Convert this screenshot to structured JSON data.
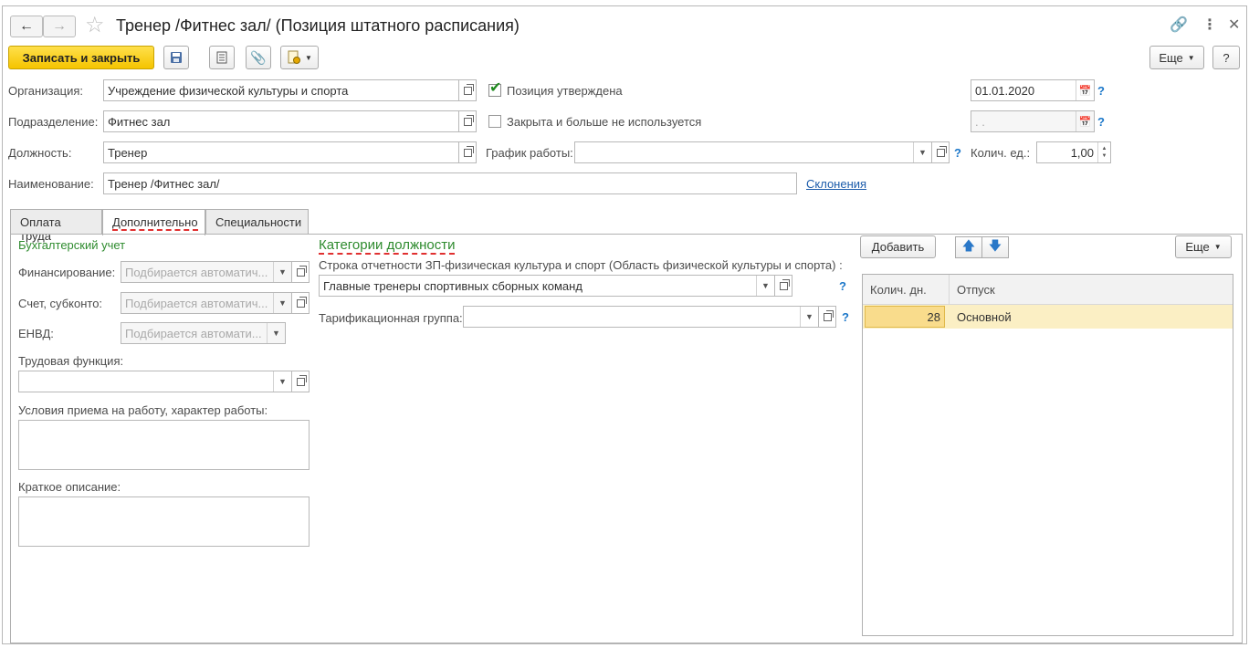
{
  "header": {
    "title": "Тренер /Фитнес зал/ (Позиция штатного расписания)"
  },
  "toolbar": {
    "save_close": "Записать и закрыть",
    "more": "Еще",
    "help": "?"
  },
  "form": {
    "org_label": "Организация:",
    "org_value": "Учреждение физической культуры и спорта",
    "dept_label": "Подразделение:",
    "dept_value": "Фитнес зал",
    "pos_label": "Должность:",
    "pos_value": "Тренер",
    "name_label": "Наименование:",
    "name_value": "Тренер /Фитнес зал/",
    "declensions": "Склонения",
    "approved_label": "Позиция утверждена",
    "approved_checked": true,
    "closed_label": "Закрыта и больше не используется",
    "approved_date": "01.01.2020",
    "closed_date": " .  .",
    "schedule_label": "График работы:",
    "schedule_value": "",
    "qty_label": "Колич. ед.:",
    "qty_value": "1,00",
    "help": "?"
  },
  "tabs": [
    {
      "label": "Оплата труда",
      "active": false
    },
    {
      "label": "Дополнительно",
      "active": true
    },
    {
      "label": "Специальности",
      "active": false
    }
  ],
  "accounting": {
    "heading": "Бухгалтерский учет",
    "financing_label": "Финансирование:",
    "financing_placeholder": "Подбирается автоматич...",
    "account_label": "Счет, субконто:",
    "account_placeholder": "Подбирается автоматич...",
    "envd_label": "ЕНВД:",
    "envd_placeholder": "Подбирается автомати...",
    "labor_function_label": "Трудовая функция:",
    "conditions_label": "Условия приема на работу, характер работы:",
    "brief_label": "Краткое описание:"
  },
  "categories": {
    "heading": "Категории должности",
    "report_label": "Строка отчетности ЗП-физическая культура и спорт (Область физической культуры и спорта) :",
    "report_value": "Главные тренеры спортивных сборных команд",
    "tariff_label": "Тарификационная группа:",
    "tariff_value": ""
  },
  "vacations": {
    "add": "Добавить",
    "more": "Еще",
    "columns": [
      "Колич. дн.",
      "Отпуск"
    ],
    "rows": [
      {
        "days": "28",
        "type": "Основной"
      }
    ]
  }
}
